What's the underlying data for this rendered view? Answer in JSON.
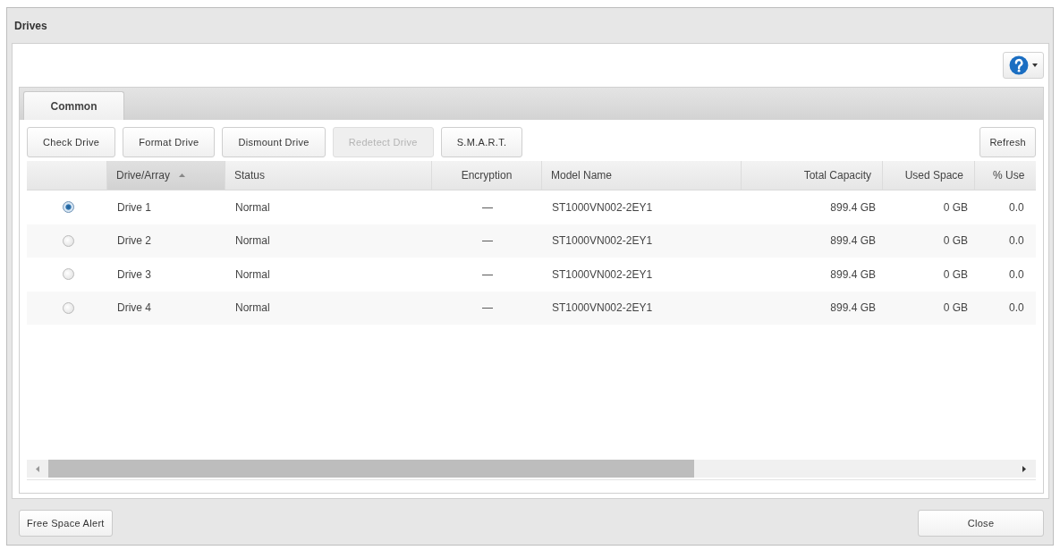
{
  "window": {
    "title": "Drives"
  },
  "tabs": [
    {
      "label": "Common",
      "selected": true
    }
  ],
  "toolbar": {
    "buttons": [
      {
        "label": "Check Drive",
        "disabled": false
      },
      {
        "label": "Format Drive",
        "disabled": false
      },
      {
        "label": "Dismount Drive",
        "disabled": false
      },
      {
        "label": "Redetect Drive",
        "disabled": true
      },
      {
        "label": "S.M.A.R.T.",
        "disabled": false
      }
    ],
    "refresh_button": "Refresh"
  },
  "table": {
    "columns": [
      {
        "label": "Drive/Array",
        "sorted": true
      },
      {
        "label": "Status",
        "sorted": false
      },
      {
        "label": "Encryption",
        "sorted": false
      },
      {
        "label": "Model Name",
        "sorted": false
      },
      {
        "label": "Total Capacity",
        "sorted": false
      },
      {
        "label": "Used Space",
        "sorted": false
      },
      {
        "label": "% Use",
        "sorted": false
      }
    ],
    "rows": [
      {
        "selected": true,
        "cells": [
          "Drive 1",
          "Normal",
          "—",
          "ST1000VN002-2EY1",
          "899.4 GB",
          "0 GB",
          "0.0"
        ]
      },
      {
        "selected": false,
        "cells": [
          "Drive 2",
          "Normal",
          "—",
          "ST1000VN002-2EY1",
          "899.4 GB",
          "0 GB",
          "0.0"
        ]
      },
      {
        "selected": false,
        "cells": [
          "Drive 3",
          "Normal",
          "—",
          "ST1000VN002-2EY1",
          "899.4 GB",
          "0 GB",
          "0.0"
        ]
      },
      {
        "selected": false,
        "cells": [
          "Drive 4",
          "Normal",
          "—",
          "ST1000VN002-2EY1",
          "899.4 GB",
          "0 GB",
          "0.0"
        ]
      }
    ]
  },
  "footer": {
    "buttons": [
      "Free Space Alert",
      "Close"
    ]
  }
}
